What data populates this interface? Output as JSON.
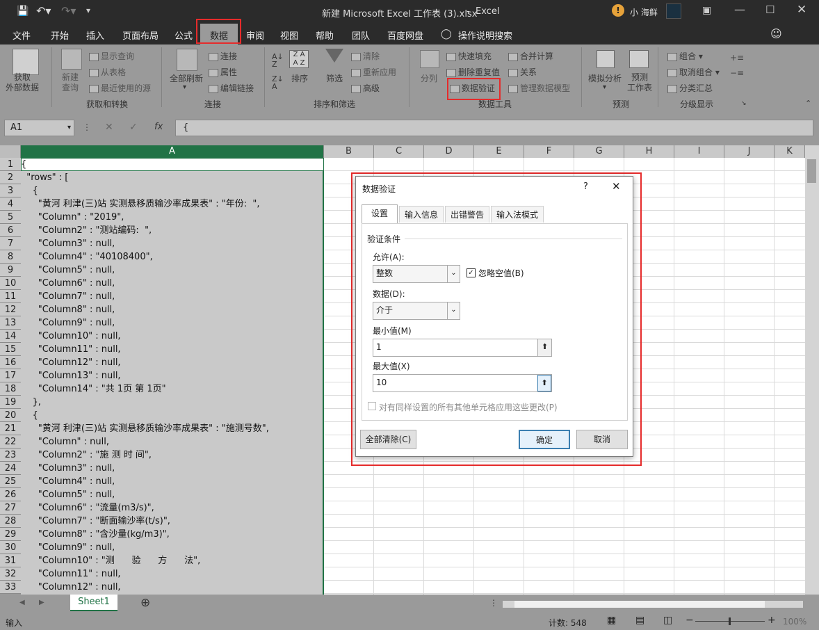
{
  "title": {
    "doc": "新建 Microsoft Excel 工作表 (3).xlsx",
    "sep": "-",
    "app": "Excel",
    "user": "小 海鲜"
  },
  "tabs": [
    "文件",
    "开始",
    "插入",
    "页面布局",
    "公式",
    "数据",
    "审阅",
    "视图",
    "帮助",
    "团队",
    "百度网盘",
    "操作说明搜索"
  ],
  "ribbon": {
    "get_external": "获取\n外部数据",
    "new_query": "新建\n查询",
    "show_query": "显示查询",
    "from_table": "从表格",
    "recent_sources": "最近使用的源",
    "group_get_transform": "获取和转换",
    "refresh_all": "全部刷新",
    "connections": "连接",
    "properties": "属性",
    "edit_links": "编辑链接",
    "group_connections": "连接",
    "sort": "排序",
    "filter": "筛选",
    "clear": "清除",
    "reapply": "重新应用",
    "advanced": "高级",
    "group_sort_filter": "排序和筛选",
    "text_to_columns": "分列",
    "flash_fill": "快速填充",
    "remove_duplicates": "删除重复值",
    "data_validation": "数据验证",
    "consolidate": "合并计算",
    "relationships": "关系",
    "manage_data_model": "管理数据模型",
    "group_data_tools": "数据工具",
    "what_if": "模拟分析",
    "forecast_sheet": "预测\n工作表",
    "group_forecast": "预测",
    "group_btn": "组合",
    "ungroup": "取消组合",
    "subtotal": "分类汇总",
    "group_outline": "分级显示"
  },
  "formula": {
    "name_box": "A1",
    "fx": "fx",
    "content": "{"
  },
  "columns": [
    "A",
    "B",
    "C",
    "D",
    "E",
    "F",
    "G",
    "H",
    "I",
    "J",
    "K"
  ],
  "rows": [
    {
      "num": "1",
      "a": "{"
    },
    {
      "num": "2",
      "a": "  \"rows\" : ["
    },
    {
      "num": "3",
      "a": "    {"
    },
    {
      "num": "4",
      "a": "      \"黄河 利津(三)站 实测悬移质输沙率成果表\" : \"年份:  \","
    },
    {
      "num": "5",
      "a": "      \"Column\" : \"2019\","
    },
    {
      "num": "6",
      "a": "      \"Column2\" : \"测站编码:  \","
    },
    {
      "num": "7",
      "a": "      \"Column3\" : null,"
    },
    {
      "num": "8",
      "a": "      \"Column4\" : \"40108400\","
    },
    {
      "num": "9",
      "a": "      \"Column5\" : null,"
    },
    {
      "num": "10",
      "a": "      \"Column6\" : null,"
    },
    {
      "num": "11",
      "a": "      \"Column7\" : null,"
    },
    {
      "num": "12",
      "a": "      \"Column8\" : null,"
    },
    {
      "num": "13",
      "a": "      \"Column9\" : null,"
    },
    {
      "num": "14",
      "a": "      \"Column10\" : null,"
    },
    {
      "num": "15",
      "a": "      \"Column11\" : null,"
    },
    {
      "num": "16",
      "a": "      \"Column12\" : null,"
    },
    {
      "num": "17",
      "a": "      \"Column13\" : null,"
    },
    {
      "num": "18",
      "a": "      \"Column14\" : \"共 1页 第 1页\""
    },
    {
      "num": "19",
      "a": "    },"
    },
    {
      "num": "20",
      "a": "    {"
    },
    {
      "num": "21",
      "a": "      \"黄河 利津(三)站 实测悬移质输沙率成果表\" : \"施测号数\","
    },
    {
      "num": "22",
      "a": "      \"Column\" : null,"
    },
    {
      "num": "23",
      "a": "      \"Column2\" : \"施 测 时 间\","
    },
    {
      "num": "24",
      "a": "      \"Column3\" : null,"
    },
    {
      "num": "25",
      "a": "      \"Column4\" : null,"
    },
    {
      "num": "26",
      "a": "      \"Column5\" : null,"
    },
    {
      "num": "27",
      "a": "      \"Column6\" : \"流量(m3/s)\","
    },
    {
      "num": "28",
      "a": "      \"Column7\" : \"断面输沙率(t/s)\","
    },
    {
      "num": "29",
      "a": "      \"Column8\" : \"含沙量(kg/m3)\","
    },
    {
      "num": "30",
      "a": "      \"Column9\" : null,"
    },
    {
      "num": "31",
      "a": "      \"Column10\" : \"测      验      方      法\","
    },
    {
      "num": "32",
      "a": "      \"Column11\" : null,"
    },
    {
      "num": "33",
      "a": "      \"Column12\" : null,"
    }
  ],
  "sheet": {
    "name": "Sheet1"
  },
  "status": {
    "mode": "输入",
    "count": "计数: 548",
    "zoom": "100%"
  },
  "dialog": {
    "title": "数据验证",
    "help": "?",
    "tabs": [
      "设置",
      "输入信息",
      "出错警告",
      "输入法模式"
    ],
    "section": "验证条件",
    "allow_label": "允许(A):",
    "allow_value": "整数",
    "ignore_blank": "忽略空值(B)",
    "data_label": "数据(D):",
    "data_value": "介于",
    "min_label": "最小值(M)",
    "min_value": "1",
    "max_label": "最大值(X)",
    "max_value": "10",
    "apply_all": "对有同样设置的所有其他单元格应用这些更改(P)",
    "clear_all": "全部清除(C)",
    "ok": "确定",
    "cancel": "取消"
  },
  "colors": {
    "accent_red": "#e52b2b",
    "excel_green": "#217346",
    "title_dark": "#2b2b2b"
  }
}
